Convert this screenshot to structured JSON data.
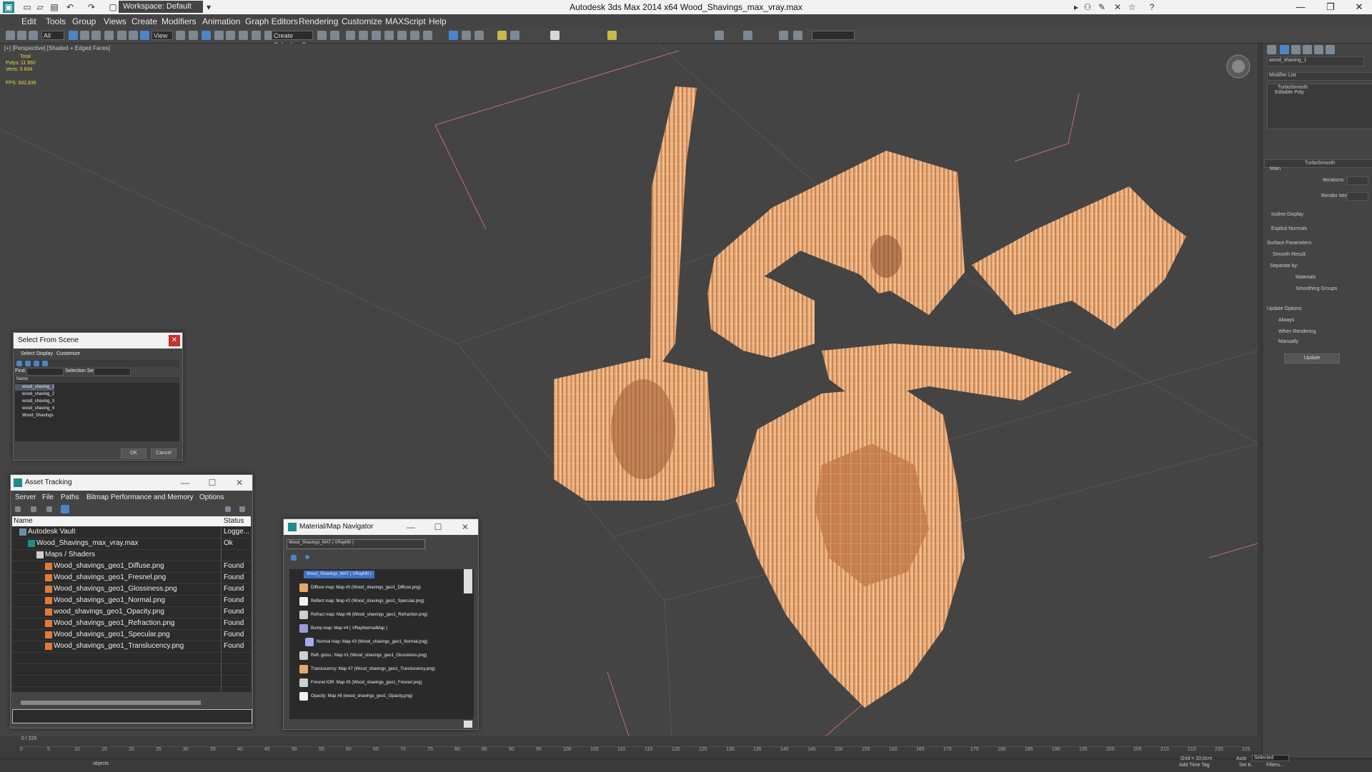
{
  "app": {
    "title": "Autodesk 3ds Max  2014 x64    Wood_Shavings_max_vray.max",
    "workspace": "Workspace: Default"
  },
  "menu": [
    "Edit",
    "Tools",
    "Group",
    "Views",
    "Create",
    "Modifiers",
    "Animation",
    "Graph Editors",
    "Rendering",
    "Customize",
    "MAXScript",
    "Help"
  ],
  "toolbar": {
    "selection_filter": "All",
    "ref_coord": "View",
    "named_selection": "Create Selection Se"
  },
  "viewport": {
    "label": "[+] [Perspective] [Shaded + Edged Faces]",
    "stats": {
      "header": "Total",
      "polys_label": "Polys:",
      "polys": "11 892",
      "verts_label": "Verts:",
      "verts": "5 834",
      "fps_label": "FPS:",
      "fps": "932,836"
    }
  },
  "command_panel": {
    "object_name": "wood_shaving_1",
    "modifier_list": "Modifier List",
    "stack": [
      "TurboSmooth",
      "Editable Poly"
    ],
    "turbosmooth_title": "TurboSmooth",
    "main": "Main",
    "iterations": "Iterations:",
    "render_iters": "Render Iters:",
    "isoline": "Isoline Display",
    "explicit_normals": "Explicit Normals",
    "surface_params": "Surface Parameters",
    "smooth_result": "Smooth Result",
    "separate_by": "Separate by:",
    "materials": "Materials",
    "smoothing_groups": "Smoothing Groups",
    "update_options": "Update Options",
    "always": "Always",
    "when_rendering": "When Rendering",
    "manually": "Manually",
    "update_btn": "Update"
  },
  "select_from_scene": {
    "title": "Select From Scene",
    "menus": [
      "Select",
      "Display",
      "Customize"
    ],
    "find_label": "Find:",
    "selection_set_label": "Selection Set:",
    "column_name": "Name",
    "items": [
      "wood_shaving_1",
      "wood_shaving_2",
      "wood_shaving_3",
      "wood_shaving_4",
      "Wood_Shavings"
    ],
    "ok": "OK",
    "cancel": "Cancel"
  },
  "asset_tracking": {
    "title": "Asset Tracking",
    "menus": [
      "Server",
      "File",
      "Paths",
      "Bitmap Performance and Memory",
      "Options"
    ],
    "col_name": "Name",
    "col_status": "Status",
    "rows": [
      {
        "name": "Autodesk Vault",
        "status": "Logge...",
        "indent": 1
      },
      {
        "name": "Wood_Shavings_max_vray.max",
        "status": "Ok",
        "indent": 2
      },
      {
        "name": "Maps / Shaders",
        "status": "",
        "indent": 3
      },
      {
        "name": "Wood_shavings_geo1_Diffuse.png",
        "status": "Found",
        "indent": 4
      },
      {
        "name": "Wood_shavings_geo1_Fresnel.png",
        "status": "Found",
        "indent": 4
      },
      {
        "name": "Wood_shavings_geo1_Glossiness.png",
        "status": "Found",
        "indent": 4
      },
      {
        "name": "Wood_shavings_geo1_Normal.png",
        "status": "Found",
        "indent": 4
      },
      {
        "name": "wood_shavings_geo1_Opacity.png",
        "status": "Found",
        "indent": 4
      },
      {
        "name": "Wood_shavings_geo1_Refraction.png",
        "status": "Found",
        "indent": 4
      },
      {
        "name": "Wood_shavings_geo1_Specular.png",
        "status": "Found",
        "indent": 4
      },
      {
        "name": "Wood_shavings_geo1_Translucency.png",
        "status": "Found",
        "indent": 4
      }
    ]
  },
  "material_navigator": {
    "title": "Material/Map Navigator",
    "field": "Wood_Shavings_MAT  ( VRayMtl )",
    "root": "Wood_Shavings_MAT  ( VRayMtl )",
    "maps": [
      "Diffuse map: Map #0 (Wood_shavings_geo1_Diffuse.png)",
      "Reflect map: Map #2 (Wood_shavings_geo1_Specular.png)",
      "Refract map: Map #6 (Wood_shavings_geo1_Refraction.png)",
      "Bump map: Map #4  ( VRayNormalMap )",
      "Normal map: Map #3 (Wood_shavings_geo1_Normal.png)",
      "Refl. gloss.: Map #1 (Wood_shavings_geo1_Glossiness.png)",
      "Translucency: Map #7 (Wood_shavings_geo1_Translucency.png)",
      "Fresnel IOR: Map #5 (Wood_shavings_geo1_Fresnel.png)",
      "Opacity: Map #8 (wood_shavings_geo1_Opacity.png)"
    ]
  },
  "timeline": {
    "frame": "0 / 225",
    "ticks": [
      "0",
      "5",
      "10",
      "15",
      "20",
      "25",
      "30",
      "35",
      "40",
      "45",
      "50",
      "55",
      "60",
      "65",
      "70",
      "75",
      "80",
      "85",
      "90",
      "95",
      "100",
      "105",
      "110",
      "115",
      "120",
      "125",
      "130",
      "135",
      "140",
      "145",
      "150",
      "155",
      "160",
      "165",
      "170",
      "175",
      "180",
      "185",
      "190",
      "195",
      "200",
      "205",
      "210",
      "215",
      "220",
      "225"
    ]
  },
  "status": {
    "objects": "objects",
    "grid": "Grid = 10,0cm",
    "auto": "Auto",
    "selected": "Selected",
    "set_k": "Set K.",
    "filters": "Filters...",
    "add_time_tag": "Add Time Tag"
  },
  "colors": {
    "wood": "#e3a872",
    "wood_dark": "#b86a3c",
    "grid_red": "#c46a7a"
  }
}
